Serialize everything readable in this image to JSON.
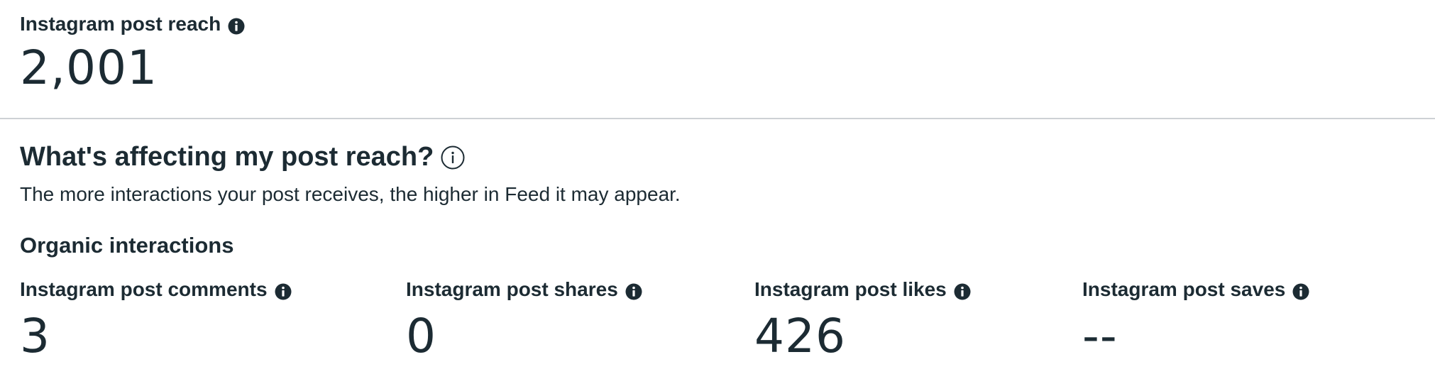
{
  "reach": {
    "label": "Instagram post reach",
    "value": "2,001",
    "info_icon": "info-icon"
  },
  "affecting": {
    "heading": "What's affecting my post reach?",
    "info_icon": "info-outline-icon",
    "description": "The more interactions your post receives, the higher in Feed it may appear."
  },
  "organic": {
    "heading": "Organic interactions",
    "metrics": [
      {
        "label": "Instagram post comments",
        "value": "3",
        "icon": "info-icon"
      },
      {
        "label": "Instagram post shares",
        "value": "0",
        "icon": "info-icon"
      },
      {
        "label": "Instagram post likes",
        "value": "426",
        "icon": "info-icon"
      },
      {
        "label": "Instagram post saves",
        "value": "--",
        "icon": "info-icon"
      }
    ]
  },
  "colors": {
    "text": "#1c2b33",
    "divider": "#cdd1d5",
    "background": "#ffffff"
  }
}
